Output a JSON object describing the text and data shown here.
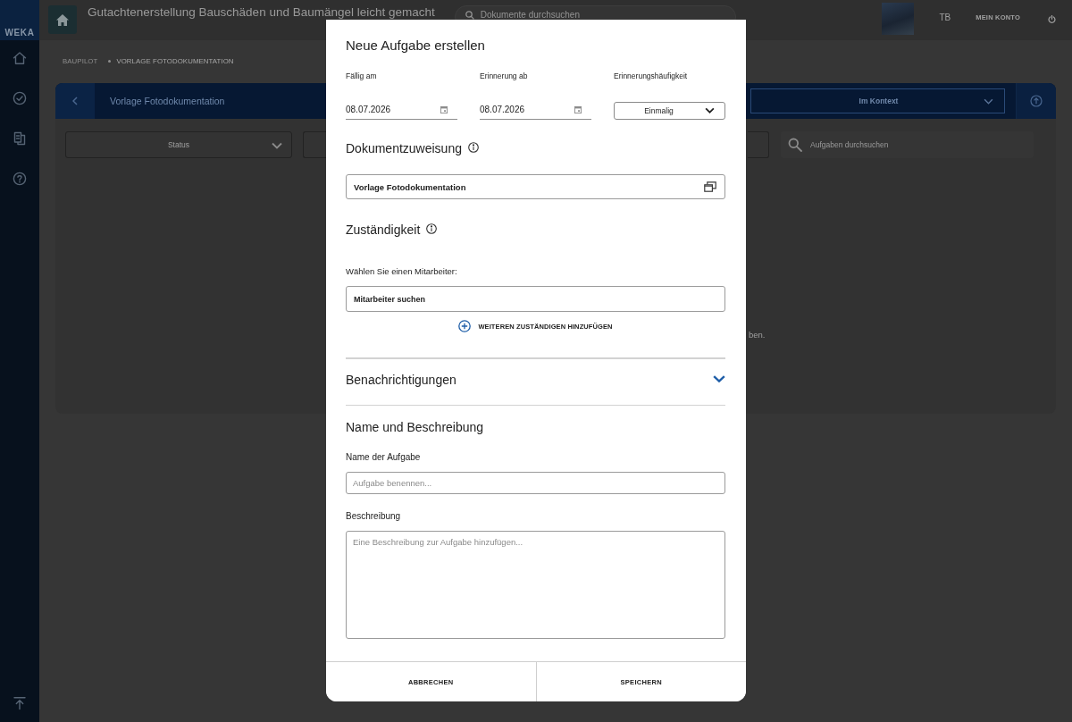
{
  "sidebar": {
    "logo": "WEKA"
  },
  "header": {
    "title": "Gutachtenerstellung Bauschäden und Baumängel leicht gemacht",
    "search": {
      "placeholder": "Dokumente durchsuchen"
    },
    "user_initials": "TB",
    "account_link": "MEIN KONTO"
  },
  "breadcrumb": [
    "BAUPILOT",
    "VORLAGE FOTODOKUMENTATION"
  ],
  "document_bar": {
    "title": "Vorlage Fotodokumentation",
    "view_select": "Im Kontext"
  },
  "filters": {
    "status_select": "Status",
    "search": {
      "placeholder": "Aufgaben durchsuchen"
    }
  },
  "empty_message_fragment": "ben.",
  "dialog": {
    "title": "Neue Aufgabe erstellen",
    "dates": [
      {
        "label": "Fällig am",
        "value": "08.07.2026"
      },
      {
        "label": "Erinnerung ab",
        "value": "08.07.2026"
      }
    ],
    "frequency": {
      "label": "Erinnerungshäufigkeit",
      "value": "Einmalig"
    },
    "document_section": {
      "heading": "Dokumentzuweisung",
      "document": "Vorlage Fotodokumentation"
    },
    "responsibility_section": {
      "heading": "Zuständigkeit",
      "prompt": "Wählen Sie einen Mitarbeiter:",
      "search": {
        "placeholder": "Mitarbeiter suchen"
      },
      "add_link": "WEITEREN ZUSTÄNDIGEN HINZUFÜGEN"
    },
    "notifications": {
      "heading": "Benachrichtigungen",
      "expanded": false
    },
    "name_section": {
      "heading": "Name und Beschreibung",
      "name": {
        "label": "Name der Aufgabe",
        "placeholder": "Aufgabe benennen..."
      },
      "description": {
        "label": "Beschreibung",
        "placeholder": "Eine Beschreibung zur Aufgabe hinzufügen..."
      }
    },
    "buttons": [
      "ABBRECHEN",
      "SPEICHERN"
    ]
  }
}
